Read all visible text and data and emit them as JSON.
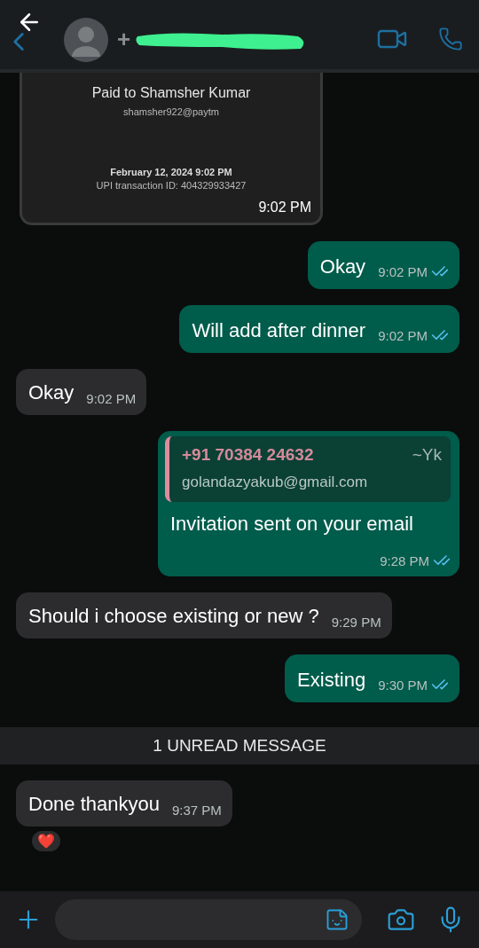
{
  "header": {
    "contact_prefix": "+"
  },
  "messages": [
    {
      "kind": "payment",
      "outgoing": false,
      "title": "Paid to Shamsher Kumar",
      "handle": "shamsher922@paytm",
      "date": "February 12, 2024 9:02 PM",
      "transaction": "UPI transaction ID: 404329933427",
      "time": "9:02 PM"
    },
    {
      "kind": "text",
      "outgoing": true,
      "text": "Okay",
      "time": "9:02 PM",
      "read": true
    },
    {
      "kind": "text",
      "outgoing": true,
      "text": "Will add after dinner",
      "time": "9:02 PM",
      "read": true
    },
    {
      "kind": "text",
      "outgoing": false,
      "text": "Okay",
      "time": "9:02 PM"
    },
    {
      "kind": "quote",
      "outgoing": true,
      "quote_author": "+91 70384 24632",
      "quote_name": "~Yk",
      "quote_text": "golandazyakub@gmail.com",
      "text": "Invitation sent on your email",
      "time": "9:28 PM",
      "read": true
    },
    {
      "kind": "text",
      "outgoing": false,
      "text": "Should i choose existing or new ?",
      "time": "9:29 PM"
    },
    {
      "kind": "text",
      "outgoing": true,
      "text": "Existing",
      "time": "9:30 PM",
      "read": true
    },
    {
      "kind": "divider",
      "text": "1 UNREAD MESSAGE"
    },
    {
      "kind": "text",
      "outgoing": false,
      "text": "Done thankyou",
      "time": "9:37 PM",
      "reaction": "❤️"
    }
  ]
}
